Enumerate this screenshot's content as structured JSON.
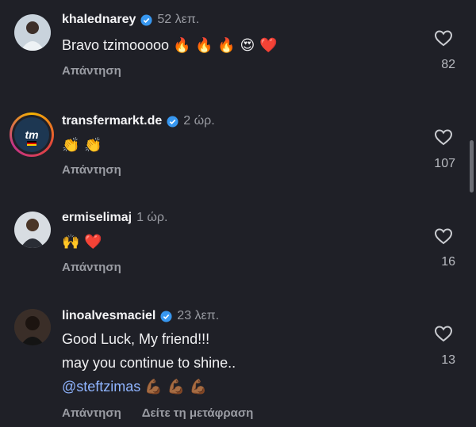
{
  "comments": [
    {
      "username": "khalednarey",
      "verified": true,
      "time": "52 λεπ.",
      "text": "Bravo tzimooooo",
      "emojis": "🔥 🔥 🔥 😍 ❤️",
      "reply_label": "Απάντηση",
      "likes": "82"
    },
    {
      "username": "transfermarkt.de",
      "verified": true,
      "time": "2 ώρ.",
      "emojis": "👏 👏",
      "reply_label": "Απάντηση",
      "likes": "107",
      "avatar_text": "tm"
    },
    {
      "username": "ermiselimaj",
      "verified": false,
      "time": "1 ώρ.",
      "emojis": "🙌 ❤️",
      "reply_label": "Απάντηση",
      "likes": "16"
    },
    {
      "username": "linoalvesmaciel",
      "verified": true,
      "time": "23 λεπ.",
      "line1": "Good Luck, My friend!!!",
      "line2": "may you continue to shine..",
      "mention": "@steftzimas",
      "emojis": "💪🏾 💪🏾 💪🏾",
      "reply_label": "Απάντηση",
      "translate_label": "Δείτε τη μετάφραση",
      "likes": "13"
    }
  ],
  "colors": {
    "background": "#1f2027",
    "verified": "#3797f0",
    "secondary_text": "#9a9ca3",
    "mention": "#8fb4ff"
  }
}
